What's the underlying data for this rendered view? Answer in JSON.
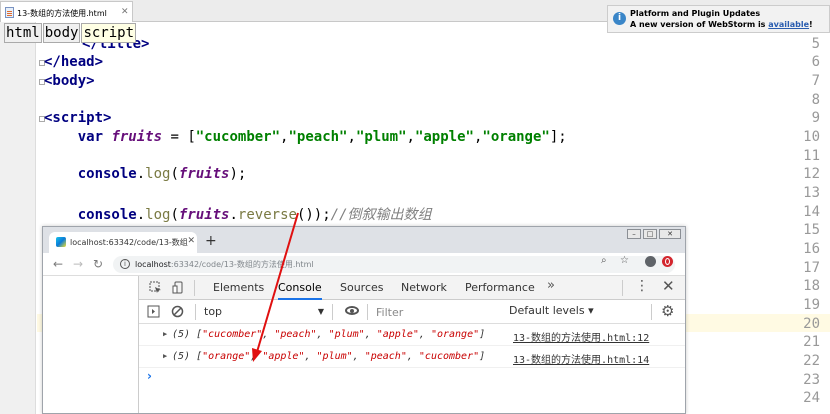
{
  "editor": {
    "tab_label": "13-数组的方法使用.html",
    "breadcrumbs": [
      "html",
      "body",
      "script"
    ],
    "line_numbers": [
      "5",
      "6",
      "7",
      "8",
      "9",
      "10",
      "11",
      "12",
      "13",
      "14",
      "15",
      "16",
      "17",
      "18",
      "19",
      "20",
      "21",
      "22",
      "23",
      "24"
    ],
    "lines": {
      "l5": "</title>",
      "l6": "</head>",
      "l7": "<body>",
      "l9": "<script>",
      "l10_var": "var",
      "l10_name": "fruits",
      "l10_eq": " = [",
      "l10_items": [
        "\"cucomber\"",
        "\"peach\"",
        "\"plum\"",
        "\"apple\"",
        "\"orange\""
      ],
      "l10_end": "];",
      "l12_console": "console",
      "l12_log": "log",
      "l12_arg": "fruits",
      "l12_end": ");",
      "l14_console": "console",
      "l14_log": "log",
      "l14_arg": "fruits",
      "l14_reverse": "reverse",
      "l14_end": "());",
      "l14_comment": "//倒叙输出数组"
    }
  },
  "notification": {
    "title": "Platform and Plugin Updates",
    "body": "A new version of WebStorm is",
    "link": "available",
    "trailing": "!"
  },
  "browser": {
    "tab_title": "localhost:63342/code/13-数组",
    "url_host": "localhost",
    "url_path": ":63342/code/13-数组的方法使用.html",
    "devtools": {
      "tabs": [
        "Elements",
        "Console",
        "Sources",
        "Network",
        "Performance"
      ],
      "active_tab": "Console",
      "more": "»",
      "context": "top",
      "filter_placeholder": "Filter",
      "levels": "Default levels ▾",
      "logs": [
        {
          "count": "(5)",
          "items": [
            "\"cucomber\"",
            "\"peach\"",
            "\"plum\"",
            "\"apple\"",
            "\"orange\""
          ],
          "source": "13-数组的方法使用.html:12"
        },
        {
          "count": "(5)",
          "items": [
            "\"orange\"",
            "\"apple\"",
            "\"plum\"",
            "\"peach\"",
            "\"cucomber\""
          ],
          "source": "13-数组的方法使用.html:14"
        }
      ],
      "prompt": "›"
    }
  },
  "colors": {
    "annotation_arrow": "#e01010",
    "string": "#008000",
    "keyword": "#000080",
    "console_string": "#c80000"
  }
}
